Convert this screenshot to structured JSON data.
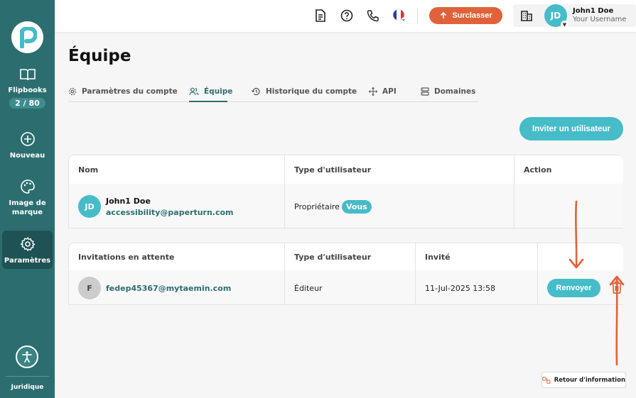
{
  "sidebar": {
    "items": [
      {
        "label": "Flipbooks",
        "badge": "2 / 80",
        "icon": "book-icon"
      },
      {
        "label": "Nouveau",
        "icon": "plus-circle-icon"
      },
      {
        "label_line1": "Image de",
        "label_line2": "marque",
        "icon": "palette-icon"
      },
      {
        "label": "Paramètres",
        "icon": "gear-icon",
        "active": true
      }
    ],
    "legal": "Juridique"
  },
  "topbar": {
    "upgrade_label": "Surclasser",
    "user_initials": "JD",
    "user_name": "John1 Doe",
    "user_handle": "Your Username"
  },
  "page": {
    "title": "Équipe",
    "tabs": [
      {
        "label": "Paramètres du compte"
      },
      {
        "label": "Équipe",
        "active": true
      },
      {
        "label": "Historique du compte"
      },
      {
        "label": "API"
      },
      {
        "label": "Domaines"
      }
    ],
    "invite_button": "Inviter un utilisateur"
  },
  "members_table": {
    "headers": [
      "Nom",
      "Type d'utilisateur",
      "Action"
    ],
    "rows": [
      {
        "initials": "JD",
        "name": "John1 Doe",
        "email": "accessibility@paperturn.com",
        "type": "Propriétaire",
        "badge": "Vous"
      }
    ]
  },
  "invites_table": {
    "headers": [
      "Invitations en attente",
      "Type d'utilisateur",
      "Invité",
      ""
    ],
    "rows": [
      {
        "initial": "F",
        "email": "fedep45367@mytaemin.com",
        "type": "Éditeur",
        "invited": "11-Jul-2025 13:58",
        "resend_label": "Renvoyer"
      }
    ]
  },
  "feedback_label": "Retour d'information",
  "colors": {
    "sidebar": "#2c6e70",
    "accent": "#45bcc8",
    "upgrade": "#e0623a",
    "annotation": "#e0623a"
  }
}
